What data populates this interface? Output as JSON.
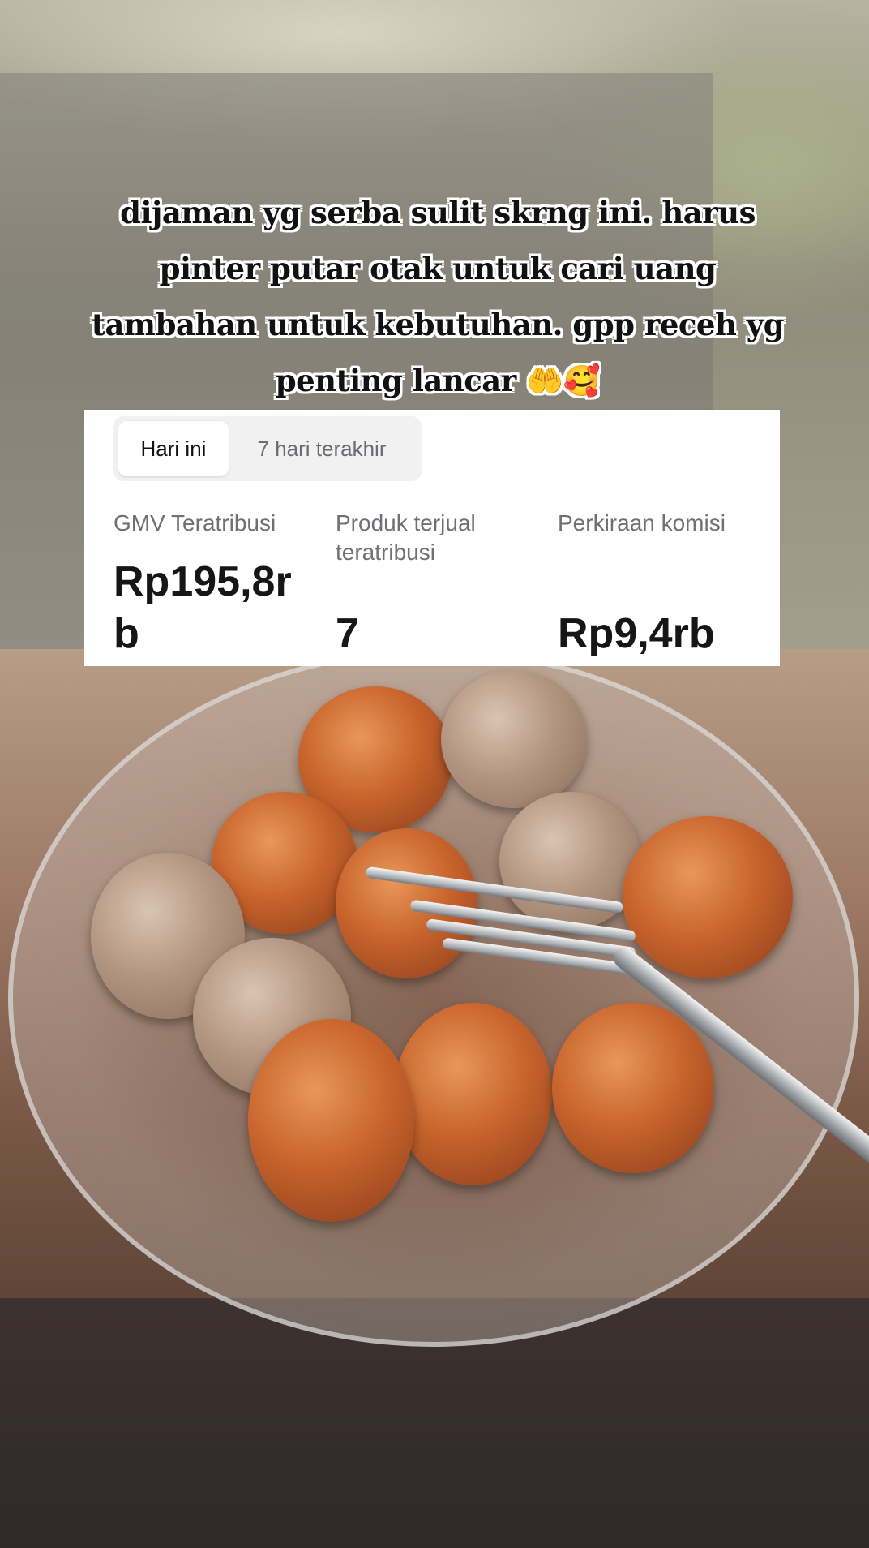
{
  "caption": {
    "text": "dijaman yg serba sulit skrng ini. harus pinter putar otak untuk cari uang tambahan untuk kebutuhan. gpp receh yg penting lancar 🤲🥰"
  },
  "stats_card": {
    "tabs": [
      {
        "label": "Hari ini",
        "active": true
      },
      {
        "label": "7 hari terakhir",
        "active": false
      }
    ],
    "metrics": [
      {
        "label": "GMV Teratribusi",
        "value": "Rp195,8rb"
      },
      {
        "label": "Produk terjual teratribusi",
        "value": "7"
      },
      {
        "label": "Perkiraan komisi",
        "value": "Rp9,4rb"
      }
    ]
  },
  "colors": {
    "card_background": "#ffffff",
    "tab_track": "#f1f1f2",
    "label_gray": "#6f6f74",
    "value_text": "#161616",
    "caption_text": "#111111",
    "caption_outline": "#ffffff"
  }
}
